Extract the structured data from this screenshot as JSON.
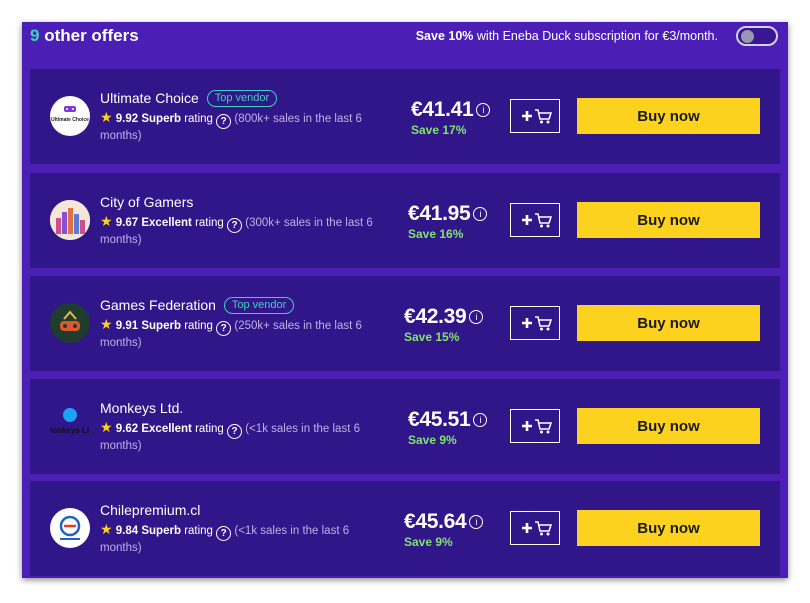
{
  "header": {
    "count": "9",
    "title": "other offers",
    "subscription_bold": "Save 10%",
    "subscription_text": "with Eneba Duck subscription for €3/month."
  },
  "offers": [
    {
      "name": "Ultimate Choice",
      "badge": "Top vendor",
      "logo_text": "Ultimate Choice",
      "score": "9.92",
      "rating_word": "Superb",
      "rating_label": "rating",
      "sales": "(800k+ sales in the last 6 months)",
      "price": "€41.41",
      "save": "Save 17%",
      "buy_label": "Buy now"
    },
    {
      "name": "City of Gamers",
      "badge": "",
      "logo_text": "",
      "score": "9.67",
      "rating_word": "Excellent",
      "rating_label": "rating",
      "sales": "(300k+ sales in the last 6 months)",
      "price": "€41.95",
      "save": "Save 16%",
      "buy_label": "Buy now"
    },
    {
      "name": "Games Federation",
      "badge": "Top vendor",
      "logo_text": "",
      "score": "9.91",
      "rating_word": "Superb",
      "rating_label": "rating",
      "sales": "(250k+ sales in the last 6 months)",
      "price": "€42.39",
      "save": "Save 15%",
      "buy_label": "Buy now"
    },
    {
      "name": "Monkeys Ltd.",
      "badge": "",
      "logo_text": "Monkeys Ltd",
      "score": "9.62",
      "rating_word": "Excellent",
      "rating_label": "rating",
      "sales": "(<1k sales in the last 6 months)",
      "price": "€45.51",
      "save": "Save 9%",
      "buy_label": "Buy now"
    },
    {
      "name": "Chilepremium.cl",
      "badge": "",
      "logo_text": "",
      "score": "9.84",
      "rating_word": "Superb",
      "rating_label": "rating",
      "sales": "(<1k sales in the last 6 months)",
      "price": "€45.64",
      "save": "Save 9%",
      "buy_label": "Buy now"
    }
  ],
  "icons": {
    "star": "star-icon",
    "question": "question-icon",
    "info": "info-icon",
    "cart": "add-to-cart-icon"
  },
  "colors": {
    "panel": "#4b1fb6",
    "row": "#31168a",
    "accent_teal": "#3ed1b9",
    "save_green": "#82e36d",
    "buy_yellow": "#fcd21e",
    "star_yellow": "#fcd21e"
  }
}
